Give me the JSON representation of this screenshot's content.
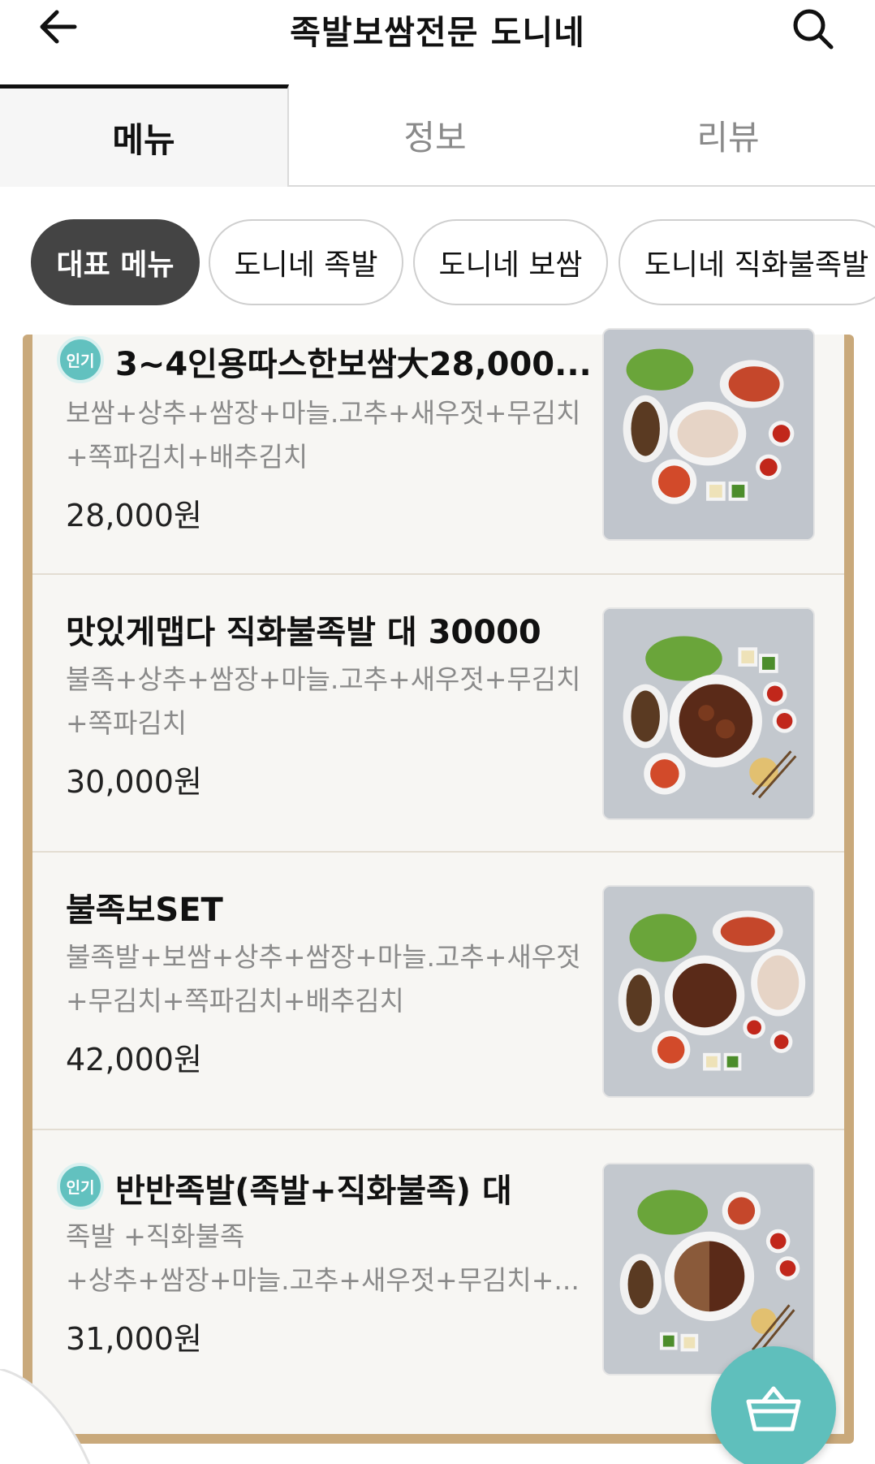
{
  "header": {
    "title": "족발보쌈전문 도니네",
    "back_icon": "arrow-left-icon",
    "search_icon": "search-icon"
  },
  "tabs": [
    {
      "label": "메뉴",
      "active": true
    },
    {
      "label": "정보",
      "active": false
    },
    {
      "label": "리뷰",
      "active": false
    }
  ],
  "categories": [
    {
      "label": "대표 메뉴",
      "active": true
    },
    {
      "label": "도니네 족발",
      "active": false
    },
    {
      "label": "도니네 보쌈",
      "active": false
    },
    {
      "label": "도니네 직화불족발",
      "active": false
    }
  ],
  "menu_items": [
    {
      "badge": "인기",
      "name": "3~4인용따스한보쌈大28,000...",
      "desc_line1": "보쌈+상추+쌈장+마늘.고추+새우젓+무김치",
      "desc_line2": "+쪽파김치+배추김치",
      "price": "28,000원"
    },
    {
      "badge": "",
      "name": "맛있게맵다 직화불족발 대 30000",
      "desc_line1": "불족+상추+쌈장+마늘.고추+새우젓+무김치",
      "desc_line2": "+쪽파김치",
      "price": "30,000원"
    },
    {
      "badge": "",
      "name": "불족보SET",
      "desc_line1": "불족발+보쌈+상추+쌈장+마늘.고추+새우젓",
      "desc_line2": "+무김치+쪽파김치+배추김치",
      "price": "42,000원"
    },
    {
      "badge": "인기",
      "name": "반반족발(족발+직화불족) 대",
      "desc_line1": "족발 +직화불족",
      "desc_line2": "+상추+쌈장+마늘.고추+새우젓+무김치+...",
      "price": "31,000원"
    }
  ],
  "cart": {
    "icon": "basket-icon"
  },
  "colors": {
    "accent": "#5fbfbc",
    "badge": "#62c1bf",
    "panel_border": "#c9a97b",
    "active_chip": "#444444"
  }
}
